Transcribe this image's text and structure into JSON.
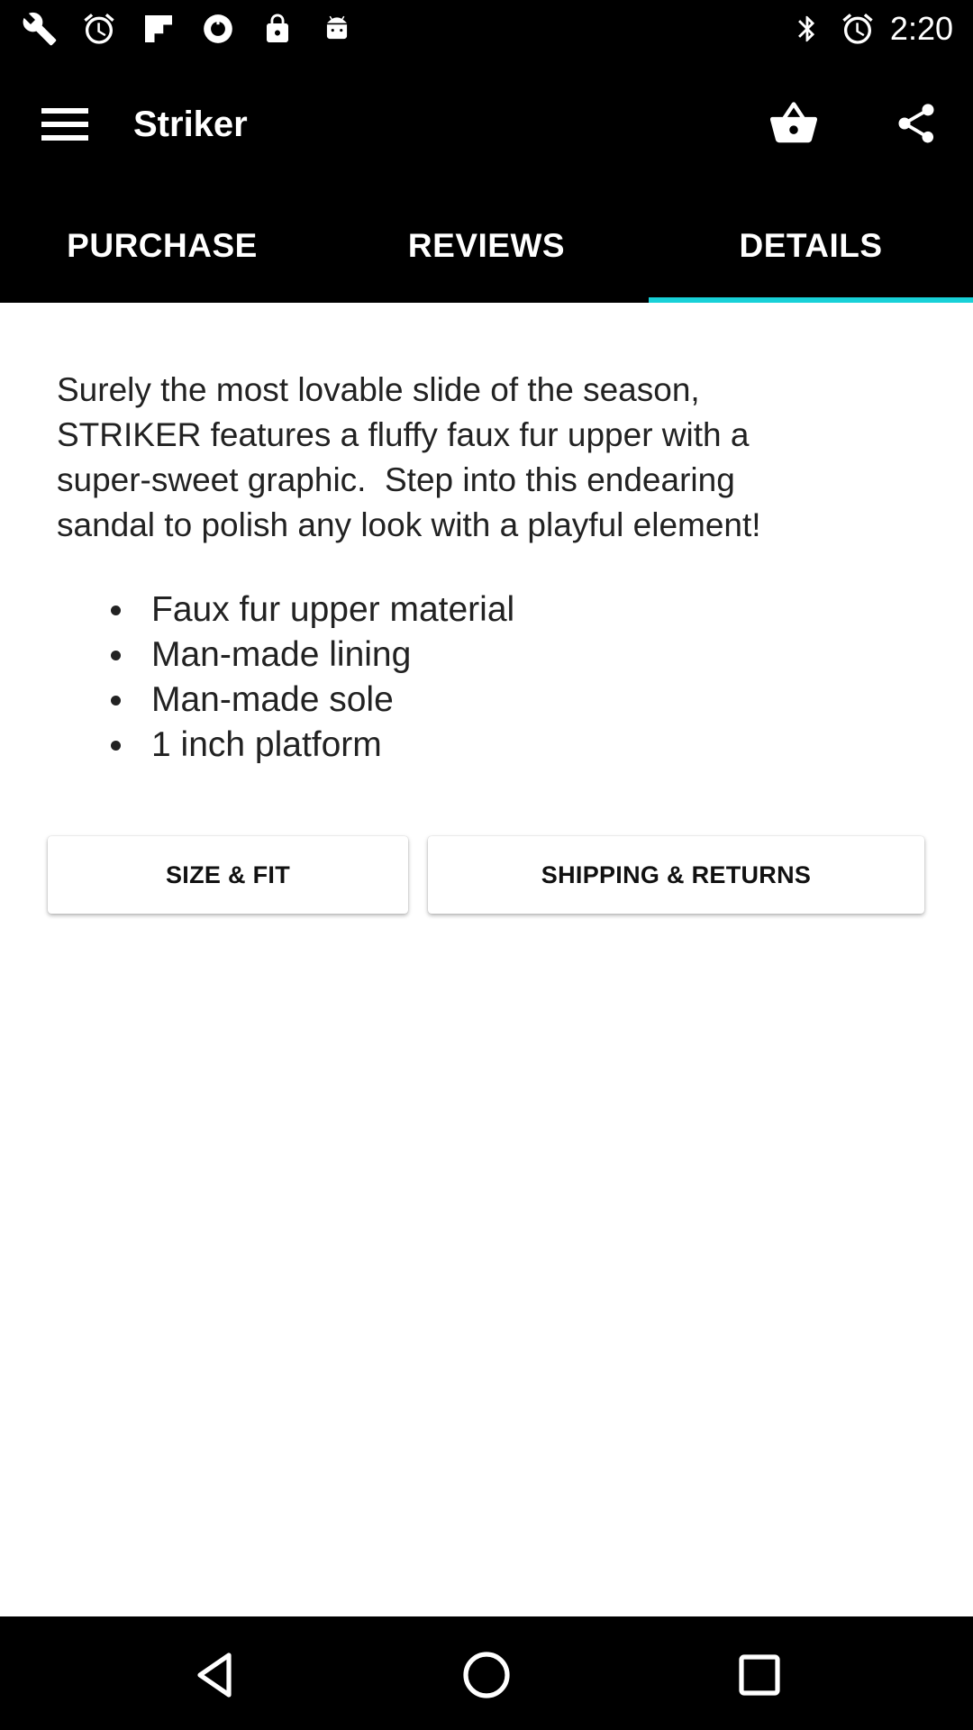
{
  "status_bar": {
    "time": "2:20",
    "left_icons": [
      "wrench-icon",
      "alarm-icon",
      "flipboard-icon",
      "sync-icon",
      "lock-icon",
      "android-icon"
    ],
    "right_icons": [
      "bluetooth-icon",
      "alarm-icon"
    ]
  },
  "app_bar": {
    "title": "Striker",
    "menu_icon": "hamburger-menu-icon",
    "cart_icon": "basket-icon",
    "share_icon": "share-icon"
  },
  "tabs": [
    {
      "label": "PURCHASE",
      "active": false
    },
    {
      "label": "REVIEWS",
      "active": false
    },
    {
      "label": "DETAILS",
      "active": true
    }
  ],
  "details": {
    "description": "Surely the most lovable slide of the season,\nSTRIKER features a fluffy faux fur upper with a\nsuper-sweet graphic.  Step into this endearing\nsandal to polish any look with a playful element!",
    "features": [
      "Faux fur upper material",
      "Man-made lining",
      "Man-made sole",
      "1 inch platform"
    ],
    "size_fit_label": "SIZE & FIT",
    "shipping_returns_label": "SHIPPING & RETURNS"
  },
  "nav_bar": {
    "icons": [
      "back-icon",
      "home-icon",
      "recents-icon"
    ]
  },
  "colors": {
    "tab_indicator": "#18d1d8",
    "background": "#000000",
    "content_background": "#ffffff"
  }
}
